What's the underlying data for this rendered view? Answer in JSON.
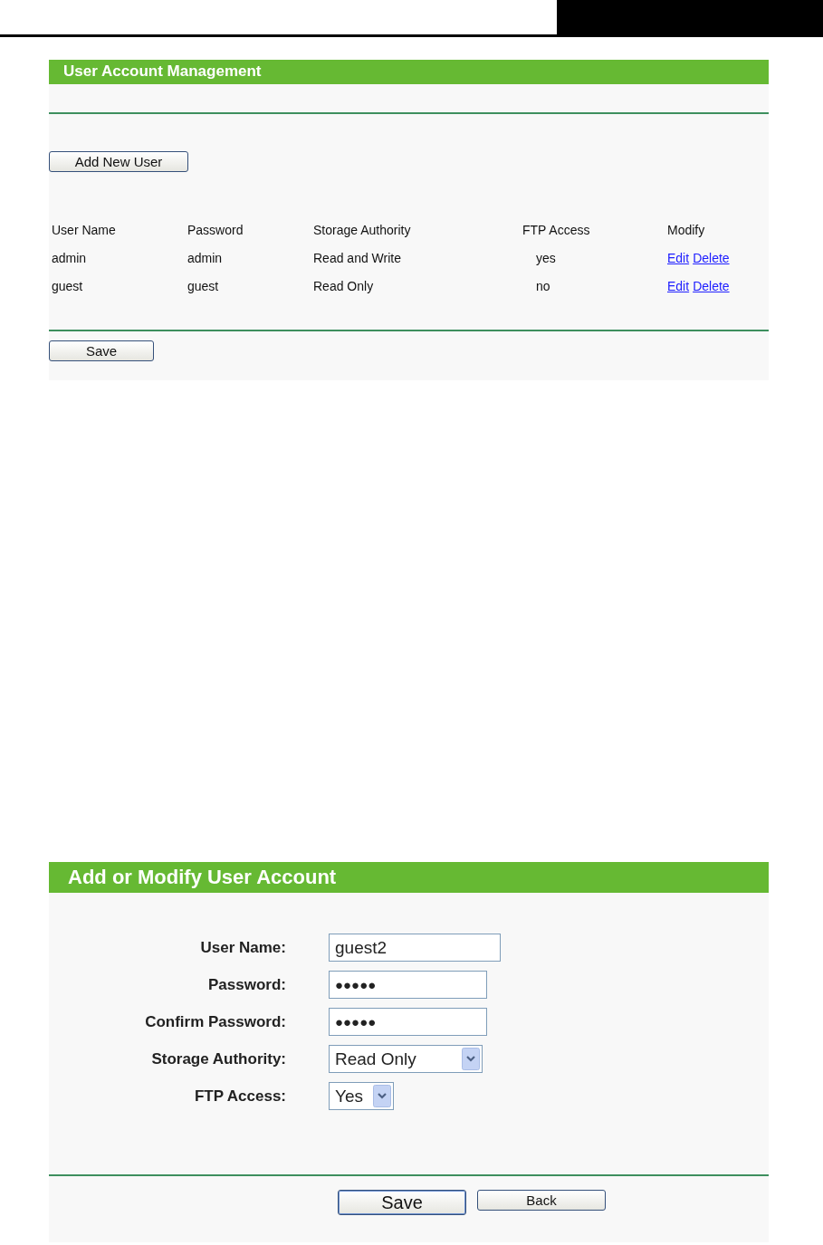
{
  "user_account_management": {
    "title": "User Account Management",
    "add_button": "Add New User",
    "table": {
      "columns": [
        "User Name",
        "Password",
        "Storage Authority",
        "FTP Access",
        "Modify"
      ],
      "rows": [
        {
          "user_name": "admin",
          "password": "admin",
          "storage_authority": "Read and Write",
          "ftp_access": "yes",
          "links": [
            "Edit",
            "Delete"
          ]
        },
        {
          "user_name": "guest",
          "password": "guest",
          "storage_authority": "Read Only",
          "ftp_access": "no",
          "links": [
            "Edit",
            "Delete"
          ]
        }
      ]
    },
    "save_button": "Save"
  },
  "add_or_modify_user_account": {
    "title": "Add or Modify User Account",
    "fields": [
      {
        "kind": "text",
        "label": "User Name:",
        "value": "guest2"
      },
      {
        "kind": "password",
        "label": "Password:",
        "value": "●●●●●"
      },
      {
        "kind": "password",
        "label": "Confirm Password:",
        "value": "●●●●●"
      },
      {
        "kind": "select",
        "label": "Storage Authority:",
        "value": "Read Only"
      },
      {
        "kind": "select",
        "label": "FTP Access:",
        "value": "Yes"
      }
    ],
    "buttons": [
      "Save",
      "Back"
    ]
  }
}
